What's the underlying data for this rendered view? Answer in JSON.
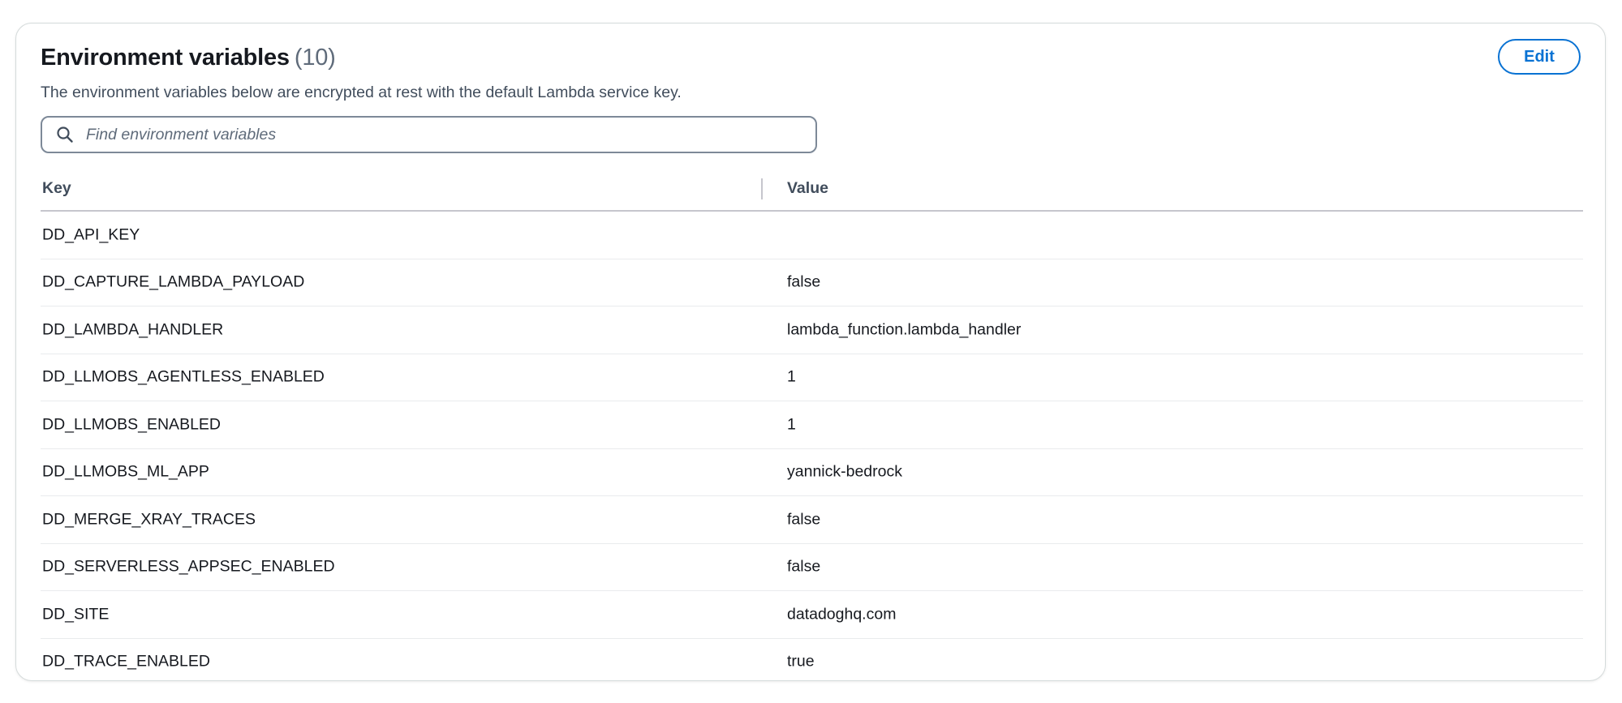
{
  "header": {
    "title": "Environment variables",
    "count": "(10)",
    "description": "The environment variables below are encrypted at rest with the default Lambda service key.",
    "edit_label": "Edit"
  },
  "search": {
    "placeholder": "Find environment variables",
    "value": "",
    "icon": "search-icon"
  },
  "table": {
    "columns": [
      "Key",
      "Value"
    ],
    "rows": [
      {
        "key": "DD_API_KEY",
        "value": ""
      },
      {
        "key": "DD_CAPTURE_LAMBDA_PAYLOAD",
        "value": "false"
      },
      {
        "key": "DD_LAMBDA_HANDLER",
        "value": "lambda_function.lambda_handler"
      },
      {
        "key": "DD_LLMOBS_AGENTLESS_ENABLED",
        "value": "1"
      },
      {
        "key": "DD_LLMOBS_ENABLED",
        "value": "1"
      },
      {
        "key": "DD_LLMOBS_ML_APP",
        "value": "yannick-bedrock"
      },
      {
        "key": "DD_MERGE_XRAY_TRACES",
        "value": "false"
      },
      {
        "key": "DD_SERVERLESS_APPSEC_ENABLED",
        "value": "false"
      },
      {
        "key": "DD_SITE",
        "value": "datadoghq.com"
      },
      {
        "key": "DD_TRACE_ENABLED",
        "value": "true"
      }
    ]
  },
  "colors": {
    "accent": "#0972d3",
    "border": "#d5dbdb",
    "text": "#16191f",
    "muted": "#5f6b7a"
  }
}
